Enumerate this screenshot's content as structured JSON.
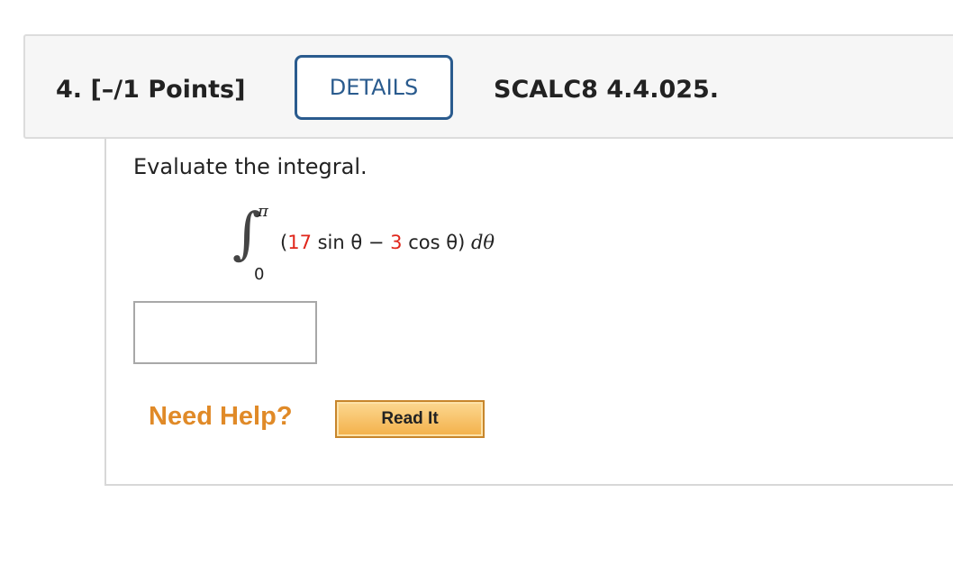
{
  "question": {
    "title": "4. [–/1 Points]",
    "details_label": "DETAILS",
    "code": "SCALC8 4.4.025."
  },
  "problem": {
    "prompt": "Evaluate the integral.",
    "integral": {
      "sign": "∫",
      "upper_limit": "π",
      "lower_limit": "0",
      "open_paren": "(",
      "coef1": "17",
      "term1": " sin θ − ",
      "coef2": "3",
      "term2": " cos θ) ",
      "differential": "dθ"
    }
  },
  "answer": {
    "value": "",
    "placeholder": ""
  },
  "help": {
    "label": "Need Help?",
    "read_it_label": "Read It"
  },
  "colors": {
    "accent_blue": "#2a5b8e",
    "highlight_red": "#e0261b",
    "help_orange": "#e08a28",
    "button_gold": "#f3b049"
  }
}
